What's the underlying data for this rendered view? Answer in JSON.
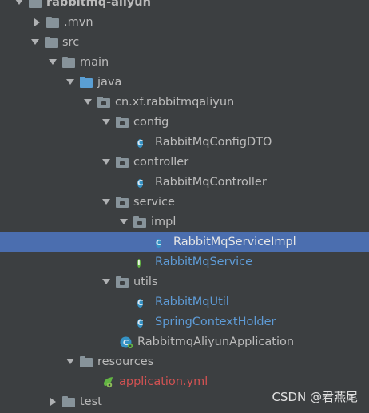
{
  "tree": {
    "root": "rabbitmq-aliyun",
    "mvn": ".mvn",
    "src": "src",
    "main": "main",
    "java": "java",
    "package": "cn.xf.rabbitmqaliyun",
    "config": "config",
    "config_dto": "RabbitMqConfigDTO",
    "controller": "controller",
    "controller_class": "RabbitMqController",
    "service": "service",
    "impl": "impl",
    "service_impl": "RabbitMqServiceImpl",
    "service_interface": "RabbitMqService",
    "utils": "utils",
    "util_class": "RabbitMqUtil",
    "context_holder": "SpringContextHolder",
    "application_class": "RabbitmqAliyunApplication",
    "resources": "resources",
    "application_yml": "application.yml",
    "test": "test"
  },
  "watermark": "CSDN @君燕尾",
  "colors": {
    "background": "#3c3f41",
    "selection": "#4b6eaf",
    "text": "#bbbbbb",
    "modified_text": "#5e9bd6",
    "unversioned_text": "#d25252"
  }
}
